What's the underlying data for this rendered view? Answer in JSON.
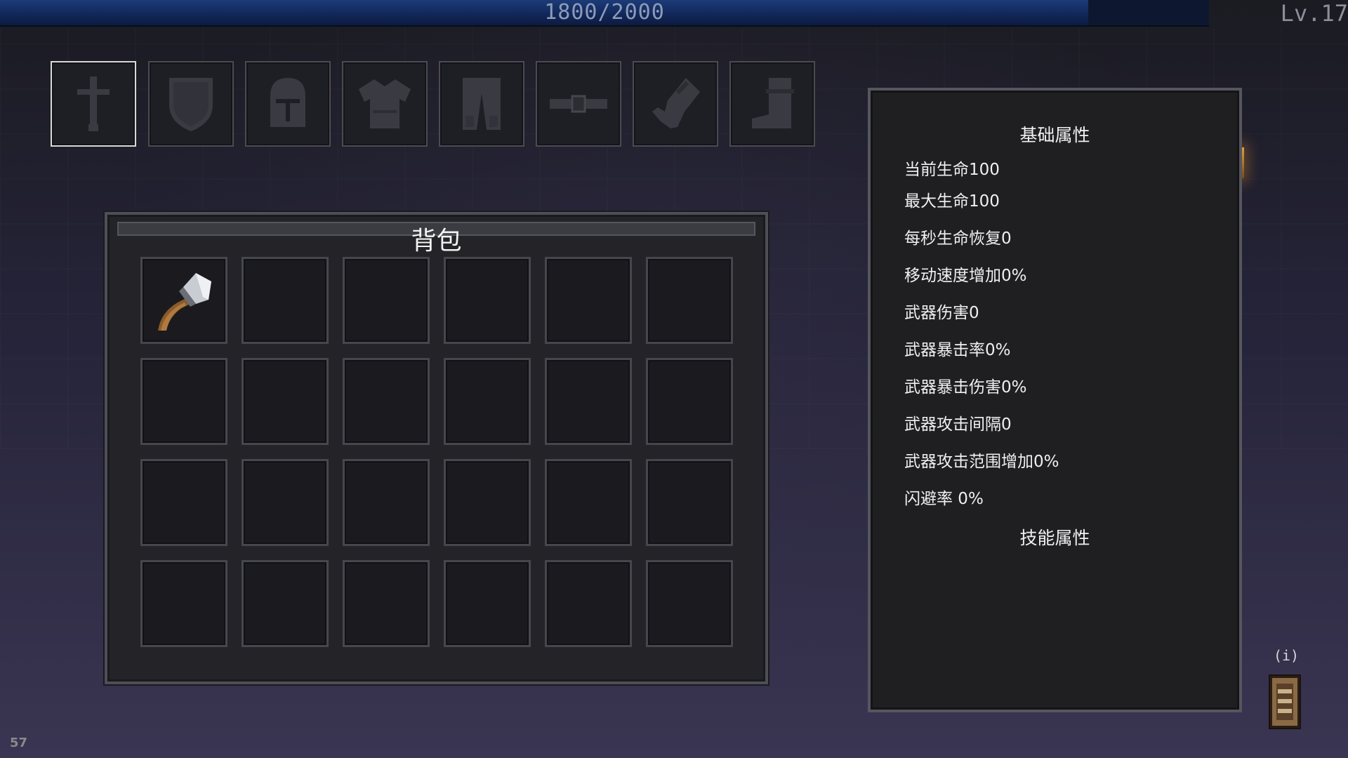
{
  "hud": {
    "xp_text": "1800/2000",
    "xp_progress": 0.9,
    "level_text": "Lv.17",
    "fps": "57"
  },
  "equipment": {
    "slots": [
      {
        "name": "weapon-slot",
        "icon": "sword-icon",
        "selected": true
      },
      {
        "name": "shield-slot",
        "icon": "shield-icon",
        "selected": false
      },
      {
        "name": "helmet-slot",
        "icon": "helmet-icon",
        "selected": false
      },
      {
        "name": "armor-slot",
        "icon": "chestplate-icon",
        "selected": false
      },
      {
        "name": "pants-slot",
        "icon": "pants-icon",
        "selected": false
      },
      {
        "name": "belt-slot",
        "icon": "belt-icon",
        "selected": false
      },
      {
        "name": "gloves-slot",
        "icon": "glove-icon",
        "selected": false
      },
      {
        "name": "boots-slot",
        "icon": "boot-icon",
        "selected": false
      }
    ]
  },
  "bag": {
    "title": "背包",
    "rows": 4,
    "cols": 6,
    "items": [
      {
        "slot": 0,
        "icon": "axe-icon"
      }
    ]
  },
  "attributes": {
    "base_title": "基础属性",
    "lines": [
      "当前生命100",
      "最大生命100",
      "每秒生命恢复0",
      "移动速度增加0%",
      "武器伤害0",
      "武器暴击率0%",
      "武器暴击伤害0%",
      "武器攻击间隔0",
      "武器攻击范围增加0%",
      "闪避率 0%"
    ],
    "skill_title": "技能属性"
  },
  "info": {
    "label": "(i)",
    "icon": "book-icon"
  },
  "colors": {
    "xp_fill": "#1c3b78",
    "panel_bg": "#242428",
    "slot_border": "#46474e"
  }
}
